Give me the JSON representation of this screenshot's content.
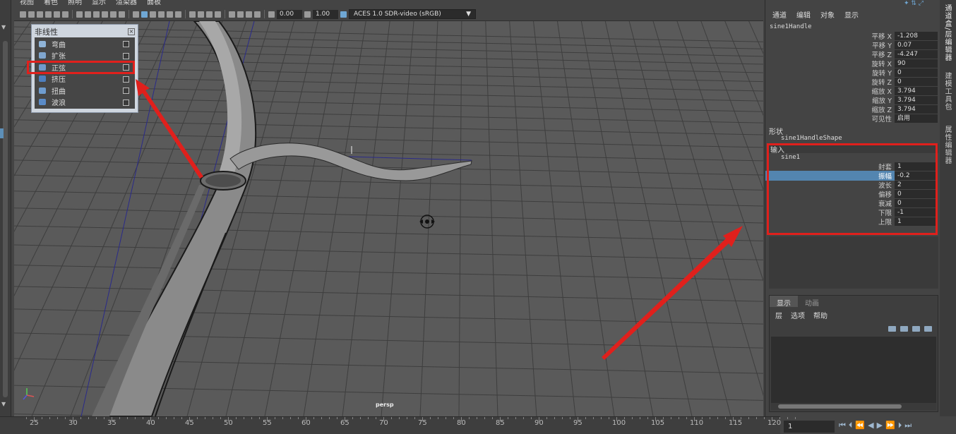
{
  "viewport": {
    "menu": [
      "视图",
      "着色",
      "照明",
      "显示",
      "渲染器",
      "面板"
    ],
    "exposure": "0.00",
    "gamma": "1.00",
    "color_space": "ACES 1.0 SDR-video (sRGB)",
    "camera": "persp"
  },
  "nonlinear_popup": {
    "title": "非线性",
    "items": [
      {
        "label": "弯曲",
        "icon": "bend-icon",
        "color": "#8fb4d8"
      },
      {
        "label": "扩张",
        "icon": "flare-icon",
        "color": "#7fa6cf"
      },
      {
        "label": "正弦",
        "icon": "sine-icon",
        "color": "#6f9bcc"
      },
      {
        "label": "挤压",
        "icon": "squash-icon",
        "color": "#4d7fbf"
      },
      {
        "label": "扭曲",
        "icon": "twist-icon",
        "color": "#6e9ccf"
      },
      {
        "label": "波浪",
        "icon": "wave-icon",
        "color": "#5a8bc8"
      }
    ]
  },
  "channel_box": {
    "menu": [
      "通道",
      "编辑",
      "对象",
      "显示"
    ],
    "node": "sine1Handle",
    "transforms": [
      {
        "label": "平移 X",
        "value": "-1.208"
      },
      {
        "label": "平移 Y",
        "value": "0.07"
      },
      {
        "label": "平移 Z",
        "value": "-4.247"
      },
      {
        "label": "旋转 X",
        "value": "90"
      },
      {
        "label": "旋转 Y",
        "value": "0"
      },
      {
        "label": "旋转 Z",
        "value": "0"
      },
      {
        "label": "缩放 X",
        "value": "3.794"
      },
      {
        "label": "缩放 Y",
        "value": "3.794"
      },
      {
        "label": "缩放 Z",
        "value": "3.794"
      },
      {
        "label": "可见性",
        "value": "启用"
      }
    ],
    "shape_title": "形状",
    "shape_node": "sine1HandleShape",
    "input_title": "输入",
    "input_node": "sine1",
    "inputs": [
      {
        "label": "封套",
        "value": "1"
      },
      {
        "label": "振幅",
        "value": "-0.2",
        "selected": true
      },
      {
        "label": "波长",
        "value": "2"
      },
      {
        "label": "偏移",
        "value": "0"
      },
      {
        "label": "衰减",
        "value": "0"
      },
      {
        "label": "下限",
        "value": "-1"
      },
      {
        "label": "上限",
        "value": "1"
      }
    ]
  },
  "layer_editor": {
    "tabs": [
      "显示",
      "动画"
    ],
    "menu": [
      "层",
      "选项",
      "帮助"
    ]
  },
  "side_tabs": [
    "通道盒/层编辑器",
    "建模工具包",
    "属性编辑器"
  ],
  "timeline": {
    "ticks": [
      "25",
      "30",
      "35",
      "40",
      "45",
      "50",
      "55",
      "60",
      "65",
      "70",
      "75",
      "80",
      "85",
      "90",
      "95",
      "100",
      "105",
      "110",
      "115",
      "120"
    ],
    "current_frame": "1"
  },
  "colors": {
    "annotation_red": "#e0201c",
    "selection_blue": "#5385b0"
  }
}
